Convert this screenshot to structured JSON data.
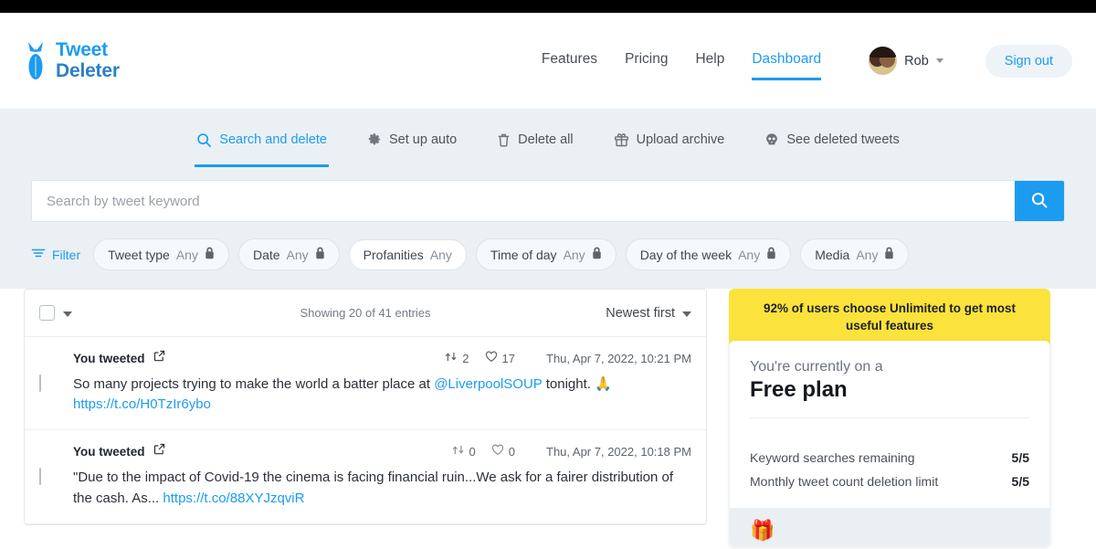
{
  "brand": {
    "line1": "Tweet",
    "line2": "Deleter",
    "logo_icon": "bomb-icon",
    "color": "#1b9cf0"
  },
  "header": {
    "nav": [
      {
        "label": "Features",
        "active": false
      },
      {
        "label": "Pricing",
        "active": false
      },
      {
        "label": "Help",
        "active": false
      },
      {
        "label": "Dashboard",
        "active": true
      }
    ],
    "user_name": "Rob",
    "user_caret_icon": "chevron-down-icon",
    "avatar_icon": "avatar",
    "sign_out_label": "Sign out"
  },
  "tabs": [
    {
      "label": "Search and delete",
      "icon": "search-icon",
      "active": true
    },
    {
      "label": "Set up auto",
      "icon": "gear-icon",
      "active": false
    },
    {
      "label": "Delete all",
      "icon": "trash-icon",
      "active": false
    },
    {
      "label": "Upload archive",
      "icon": "upload-archive-icon",
      "active": false
    },
    {
      "label": "See deleted tweets",
      "icon": "skull-icon",
      "active": false
    }
  ],
  "search": {
    "placeholder": "Search by tweet keyword",
    "value": "",
    "button_icon": "search-icon",
    "button_color": "#1b9cf0"
  },
  "filters": {
    "label": "Filter",
    "label_icon": "filter-icon",
    "chips": [
      {
        "name": "Tweet type",
        "value": "Any",
        "locked": true,
        "style": "shaded"
      },
      {
        "name": "Date",
        "value": "Any",
        "locked": true,
        "style": "shaded"
      },
      {
        "name": "Profanities",
        "value": "Any",
        "locked": false,
        "style": "plain"
      },
      {
        "name": "Time of day",
        "value": "Any",
        "locked": true,
        "style": "shaded"
      },
      {
        "name": "Day of the week",
        "value": "Any",
        "locked": true,
        "style": "shaded"
      },
      {
        "name": "Media",
        "value": "Any",
        "locked": true,
        "style": "shaded"
      }
    ]
  },
  "list": {
    "select_all_checked": false,
    "showing_text": "Showing 20 of 41 entries",
    "sort_label": "Newest first",
    "sort_caret_icon": "chevron-down-icon",
    "tweets": [
      {
        "author_label": "You tweeted",
        "external_icon": "external-link-icon",
        "retweets": "2",
        "likes": "17",
        "timestamp": "Thu, Apr 7, 2022, 10:21 PM",
        "text_before": "So many projects trying to make the world a batter place at ",
        "mention": "@LiverpoolSOUP",
        "text_after": " tonight. 🙏",
        "url": "https://t.co/H0TzIr6ybo",
        "checked": false
      },
      {
        "author_label": "You tweeted",
        "external_icon": "external-link-icon",
        "retweets": "0",
        "likes": "0",
        "timestamp": "Thu, Apr 7, 2022, 10:18 PM",
        "text_before": "\"Due to the impact of Covid-19 the cinema is facing financial ruin...We ask for a fairer distribution of the cash. As... ",
        "mention": "",
        "text_after": "",
        "url": "https://t.co/88XYJzqviR",
        "checked": false
      }
    ]
  },
  "sidebar": {
    "promo_text": "92% of users choose Unlimited to get most useful features",
    "promo_color": "#fbe33c",
    "plan_sub": "You're currently on a",
    "plan_name": "Free plan",
    "limits": [
      {
        "label": "Keyword searches remaining",
        "value": "5/5"
      },
      {
        "label": "Monthly tweet count deletion limit",
        "value": "5/5"
      }
    ],
    "gift_icon": "🎁"
  }
}
